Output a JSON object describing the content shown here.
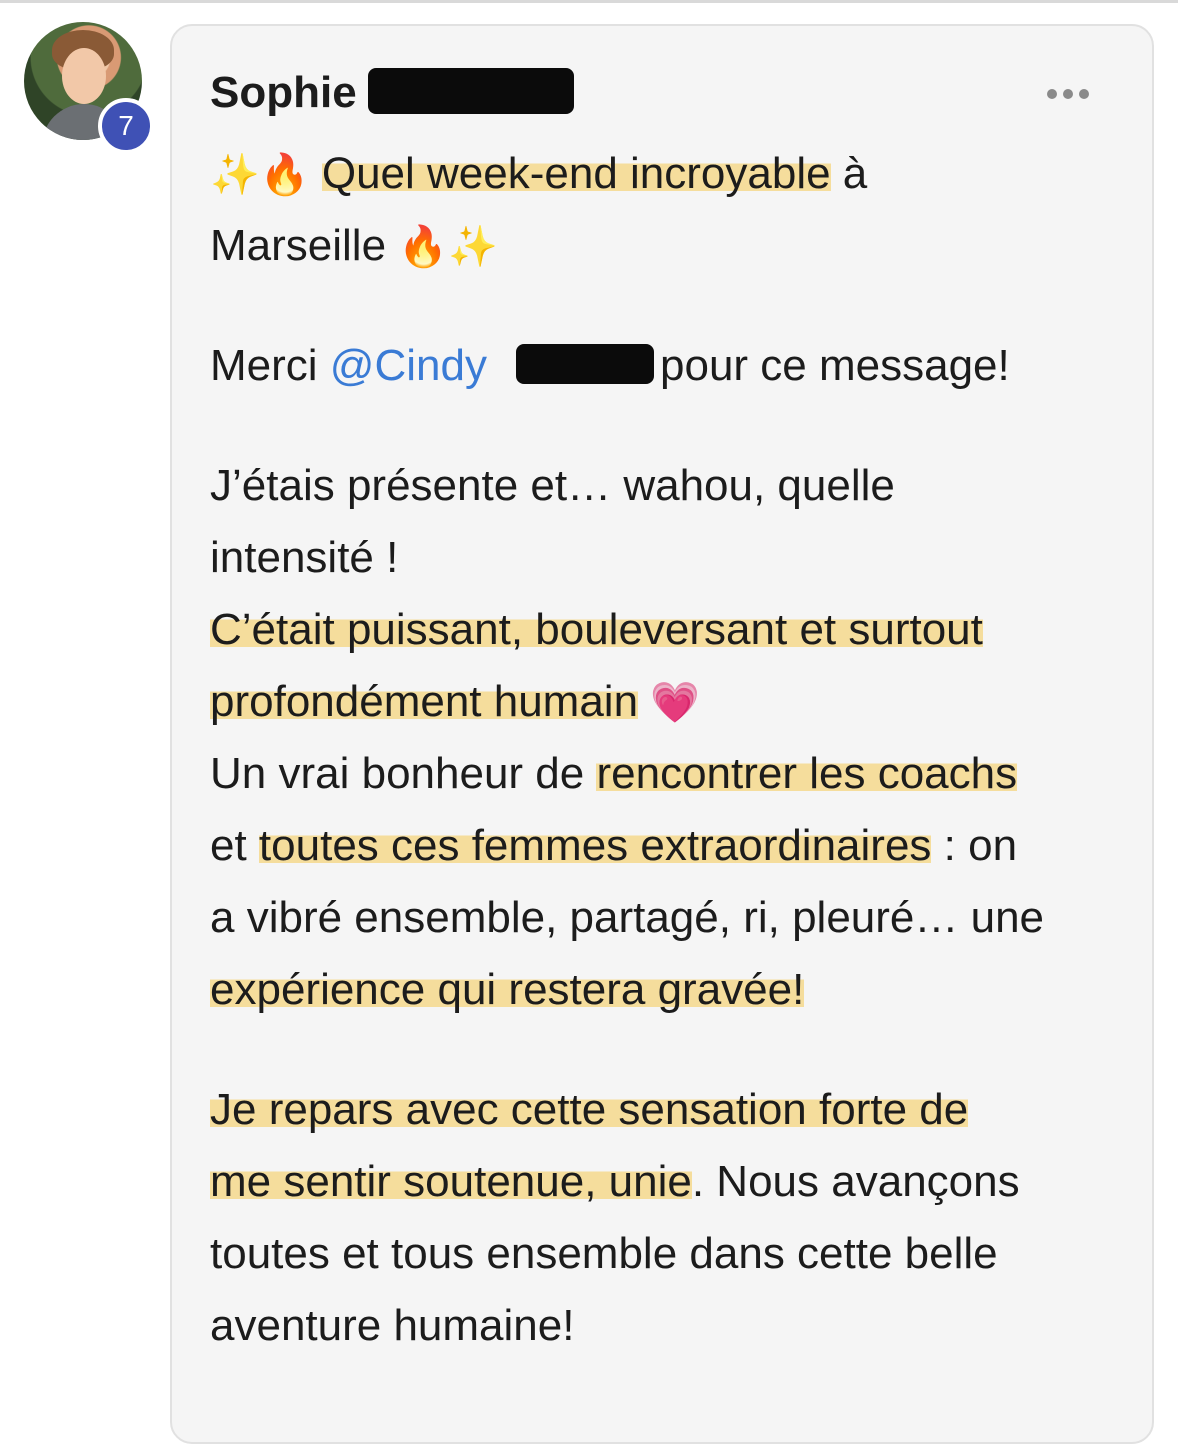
{
  "author": {
    "first_name": "Sophie",
    "badge_count": "7"
  },
  "menu": {
    "icon": "more-dots-icon"
  },
  "post": {
    "line1_emoji_before": "✨🔥",
    "line1_highlight": "Quel week-end incroyab",
    "line1_highlight_end": "le",
    "line1_tail": " à",
    "line2_text": "Marseille",
    "line2_emoji": "🔥✨",
    "line3_merci": "Merci ",
    "line3_mention": "@Cindy",
    "line3_tail": "pour ce message!",
    "line4": "J’étais présente et… wahou, quelle",
    "line5": "intensité !",
    "line6_highlight": "C’était puissant, bouleversant et surtout",
    "line7_highlight": "profondément humain",
    "line7_emoji": "💗",
    "line8_start": "Un vrai bonheur de ",
    "line8_highlight": "rencontrer les coachs",
    "line9_start": "et ",
    "line9_highlight": "toutes ces femmes extraordinaires",
    "line9_tail": " : on",
    "line10": "a vibré ensemble, partagé, ri, pleuré… une",
    "line11_highlight": "expérience qui restera gravée!",
    "line12_highlight": "Je repars avec cette sensation forte de",
    "line13_highlight": "me sentir soutenue, unie",
    "line13_tail": ". Nous avançons",
    "line14": "toutes et tous ensemble dans cette belle",
    "line15": "aventure humaine!"
  }
}
